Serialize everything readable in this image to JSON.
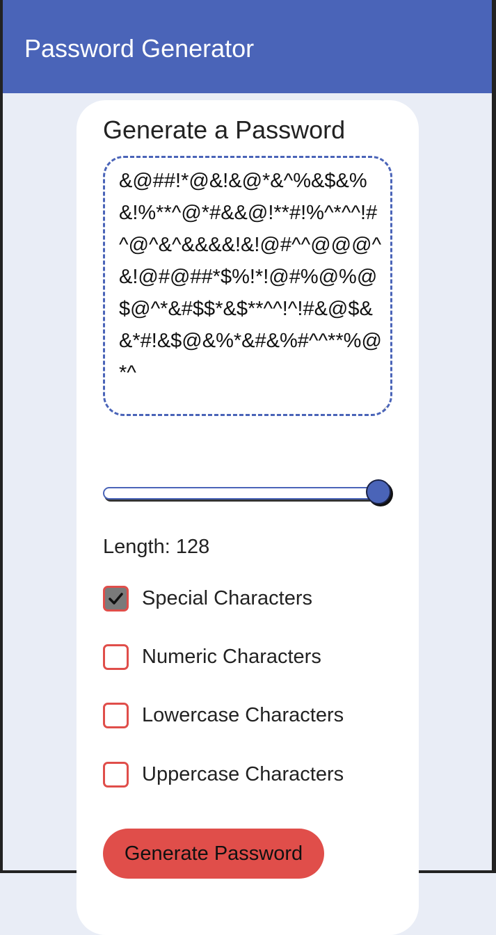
{
  "header": {
    "title": "Password Generator"
  },
  "card": {
    "title": "Generate a Password",
    "password": "&@##!*@&!&@*&^%&$&%&!%**^@*#&&@!**#!%^*^^!#^@^&^&&&&!&!@#^^@@@^&!@#@##*$%!*!@#%@%@$@^*&#$$*&$**^^!^!#&@$&&*#!&$@&%*&#&%#^^**%@*^"
  },
  "slider": {
    "value": 128,
    "min": 8,
    "max": 128
  },
  "length": {
    "label": "Length: ",
    "value": "128"
  },
  "options": [
    {
      "label": "Special Characters",
      "checked": true
    },
    {
      "label": "Numeric Characters",
      "checked": false
    },
    {
      "label": "Lowercase Characters",
      "checked": false
    },
    {
      "label": "Uppercase Characters",
      "checked": false
    }
  ],
  "generate_button": {
    "label": "Generate Password"
  },
  "colors": {
    "accent": "#4a64b8",
    "danger": "#e04e4a",
    "background": "#e9edf6",
    "card": "#ffffff"
  }
}
